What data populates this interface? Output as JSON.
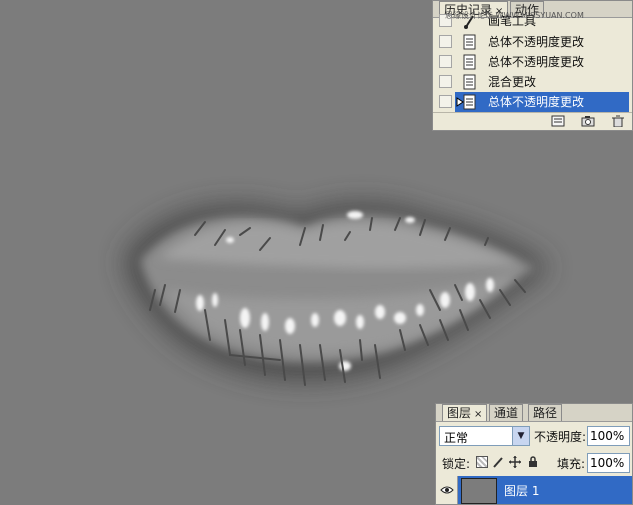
{
  "history_panel": {
    "tabs": [
      {
        "label": "历史记录",
        "close": "×"
      },
      {
        "label": "动作"
      }
    ],
    "watermark": "思缘设计论坛 WWW.MISSYUAN.COM",
    "items": [
      {
        "label": "画笔工具",
        "icon": "brush-icon",
        "selected": false
      },
      {
        "label": "总体不透明度更改",
        "icon": "history-state-icon",
        "selected": false
      },
      {
        "label": "总体不透明度更改",
        "icon": "history-state-icon",
        "selected": false
      },
      {
        "label": "混合更改",
        "icon": "history-state-icon",
        "selected": false
      },
      {
        "label": "总体不透明度更改",
        "icon": "history-state-icon",
        "selected": true
      }
    ],
    "footer_buttons": [
      "new-document-from-state-icon",
      "new-snapshot-icon",
      "trash-icon"
    ]
  },
  "layers_panel": {
    "tabs": [
      {
        "label": "图层",
        "close": "×"
      },
      {
        "label": "通道"
      },
      {
        "label": "路径"
      }
    ],
    "blend_mode": "正常",
    "opacity_label": "不透明度:",
    "opacity_value": "100%",
    "lock_label": "锁定:",
    "fill_label": "填充:",
    "fill_value": "100%",
    "layers": [
      {
        "name": "图层 1",
        "visible": true,
        "selected": true
      }
    ]
  },
  "colors": {
    "canvas": "#7c7c7c",
    "panel": "#ece9d8",
    "selection": "#316ac5"
  }
}
